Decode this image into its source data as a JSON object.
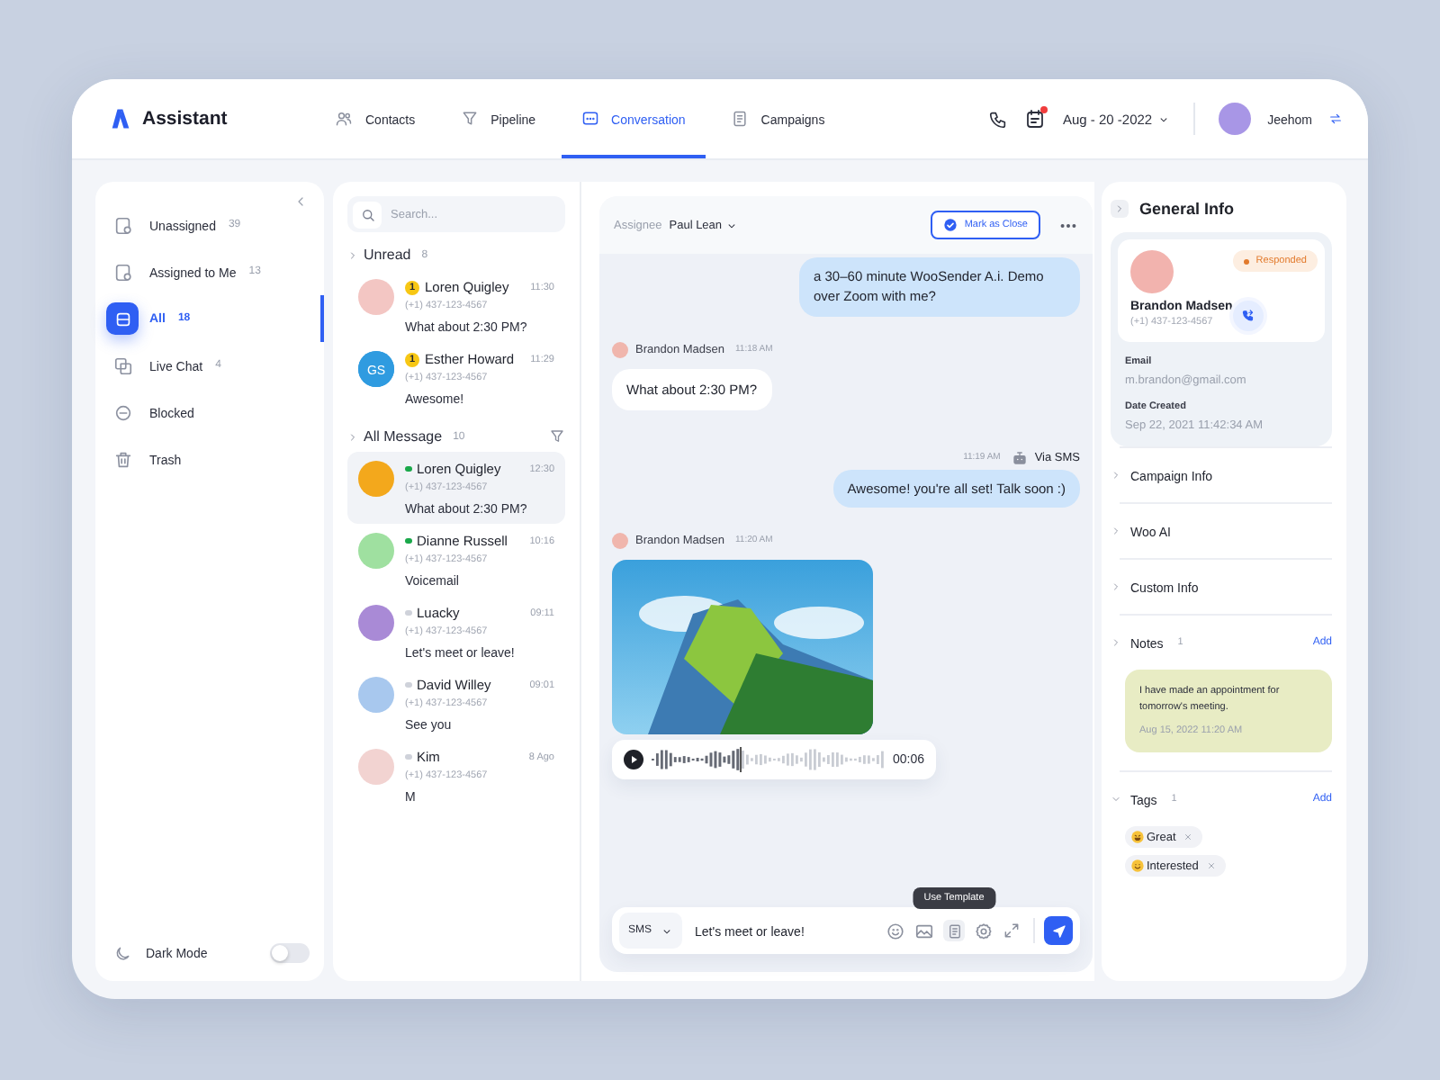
{
  "brand": {
    "name": "Assistant"
  },
  "nav": [
    {
      "label": "Contacts",
      "kind": "contacts",
      "selected": false
    },
    {
      "label": "Pipeline",
      "kind": "pipeline",
      "selected": false
    },
    {
      "label": "Conversation",
      "kind": "conversation",
      "selected": true
    },
    {
      "label": "Campaigns",
      "kind": "campaigns",
      "selected": false
    }
  ],
  "header": {
    "date": "Aug - 20 -2022",
    "alert": true,
    "user": {
      "name": "Jeehom"
    }
  },
  "sidebar": {
    "items": [
      {
        "label": "Unassigned",
        "count": "39",
        "kind": "unassigned",
        "selected": false
      },
      {
        "label": "Assigned to Me",
        "count": "13",
        "kind": "assigned",
        "selected": false
      },
      {
        "label": "All",
        "count": "18",
        "kind": "all",
        "selected": true
      },
      {
        "label": "Live Chat",
        "count": "4",
        "kind": "livechat",
        "selected": false
      },
      {
        "label": "Blocked",
        "kind": "blocked",
        "selected": false
      },
      {
        "label": "Trash",
        "kind": "trash",
        "selected": false
      }
    ],
    "dark_mode": {
      "label": "Dark Mode",
      "on": false
    }
  },
  "conversations": {
    "search": {
      "placeholder": "Search..."
    },
    "groups": [
      {
        "title": "Unread",
        "count": "8",
        "filter": false,
        "items": [
          {
            "name": "Loren Quigley",
            "phone": "(+1) 437-123-4567",
            "time": "11:30",
            "message": "What about 2:30 PM?",
            "unread": "1",
            "color": "#f3c6c3",
            "selected": false
          },
          {
            "name": "Esther Howard",
            "phone": "(+1) 437-123-4567",
            "time": "11:29",
            "message": "Awesome!",
            "unread": "1",
            "initials": "GS",
            "color": "#2f9be0",
            "selected": false
          }
        ]
      },
      {
        "title": "All Message",
        "count": "10",
        "filter": true,
        "items": [
          {
            "name": "Loren Quigley",
            "phone": "(+1) 437-123-4567",
            "time": "12:30",
            "message": "What about 2:30 PM?",
            "online": true,
            "color": "#f3a81c",
            "selected": true
          },
          {
            "name": "Dianne Russell",
            "phone": "(+1) 437-123-4567",
            "time": "10:16",
            "message": "Voicemail",
            "online": true,
            "color": "#9fe0a0",
            "selected": false
          },
          {
            "name": "Luacky",
            "phone": "(+1) 437-123-4567",
            "time": "09:11",
            "message": "Let's meet or leave!",
            "online": false,
            "color": "#a98ad6",
            "selected": false
          },
          {
            "name": "David Willey",
            "phone": "(+1) 437-123-4567",
            "time": "09:01",
            "message": "See you",
            "online": false,
            "color": "#a8c8ee",
            "selected": false
          },
          {
            "name": "Kim",
            "phone": "(+1) 437-123-4567",
            "time": "8 Ago",
            "message": "M",
            "online": false,
            "color": "#f2d3d1",
            "selected": false
          }
        ]
      }
    ]
  },
  "chat": {
    "assignee_label": "Assignee",
    "assignee": "Paul Lean",
    "close_button": "Mark as Close",
    "messages": [
      {
        "kind": "outgoing",
        "text": "a 30–60 minute WooSender A.i. Demo over Zoom with me?"
      },
      {
        "kind": "sender",
        "name": "Brandon Madsen",
        "time": "11:18 AM"
      },
      {
        "kind": "incoming",
        "text": "What about 2:30 PM?"
      },
      {
        "kind": "meta",
        "time": "11:19 AM",
        "channel": "Via SMS"
      },
      {
        "kind": "outgoing",
        "text": "Awesome! you're all set! Talk soon :)"
      },
      {
        "kind": "sender",
        "name": "Brandon Madsen",
        "time": "11:20 AM"
      },
      {
        "kind": "photo"
      },
      {
        "kind": "audio",
        "duration": "00:06",
        "level": 0.38
      }
    ],
    "composer": {
      "channel": "SMS",
      "value": "Let's meet or leave!",
      "tooltip": "Use Template"
    }
  },
  "info": {
    "title": "General Info",
    "contact": {
      "name": "Brandon Madsen",
      "phone": "(+1) 437-123-4567",
      "status": "Responded",
      "email_label": "Email",
      "email": "m.brandon@gmail.com",
      "date_label": "Date Created",
      "date": "Sep 22, 2021 11:42:34 AM"
    },
    "sections": [
      {
        "title": "Campaign Info",
        "expanded": false
      },
      {
        "title": "Woo AI",
        "expanded": false
      },
      {
        "title": "Custom Info",
        "expanded": false
      }
    ],
    "notes": {
      "title": "Notes",
      "count": "1",
      "add": "Add",
      "expanded": false,
      "items": [
        {
          "text": "I have made an appointment for tomorrow's meeting.",
          "time": "Aug 15, 2022 11:20 AM"
        }
      ]
    },
    "tags": {
      "title": "Tags",
      "count": "1",
      "add": "Add",
      "expanded": true,
      "items": [
        {
          "label": "Great",
          "kind": "grin"
        },
        {
          "label": "Interested",
          "kind": "smile"
        }
      ]
    }
  }
}
